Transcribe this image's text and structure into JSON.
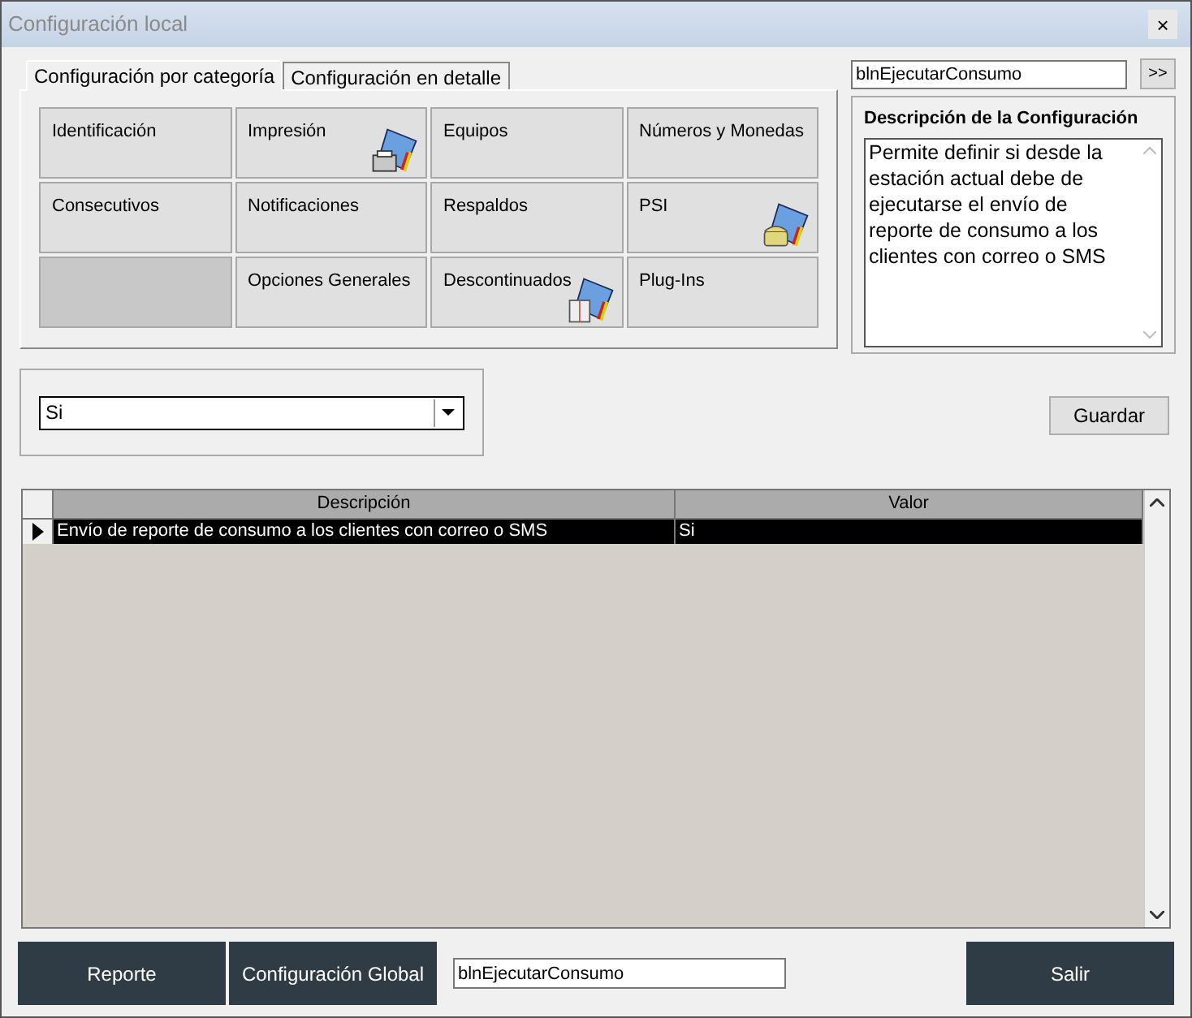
{
  "window": {
    "title": "Configuración local",
    "close": "×"
  },
  "tabs": [
    {
      "label": "Configuración por categoría",
      "selected": true
    },
    {
      "label": "Configuración en detalle",
      "selected": false
    }
  ],
  "categories": [
    {
      "label": "Identificación",
      "disabled": false
    },
    {
      "label": "Impresión",
      "disabled": false,
      "kind": "printer"
    },
    {
      "label": "Equipos",
      "disabled": false
    },
    {
      "label": "Números y Monedas",
      "disabled": false
    },
    {
      "label": "Consecutivos",
      "disabled": false
    },
    {
      "label": "Notificaciones",
      "disabled": false
    },
    {
      "label": "Respaldos",
      "disabled": false
    },
    {
      "label": "PSI",
      "disabled": false,
      "kind": "phone"
    },
    {
      "disabled": true
    },
    {
      "label": "Opciones Generales",
      "disabled": false
    },
    {
      "label": "Descontinuados",
      "disabled": false,
      "kind": "book"
    },
    {
      "label": "Plug-Ins",
      "disabled": false
    }
  ],
  "search": {
    "value": "blnEjecutarConsumo",
    "button": ">>"
  },
  "description": {
    "title": "Descripción de la Configuración",
    "text": "Permite definir si desde la estación actual debe de ejecutarse el envío de reporte de consumo a los clientes con correo o SMS"
  },
  "value_select": {
    "value": "Si"
  },
  "save_button": "Guardar",
  "table": {
    "columns": [
      "Descripción",
      "Valor"
    ],
    "rows": [
      {
        "cells": [
          "Envío de reporte de consumo a los clientes con correo o SMS",
          "Si"
        ],
        "selected": true
      }
    ]
  },
  "footer": {
    "buttons": [
      "Reporte",
      "Configuración Global"
    ],
    "field": "blnEjecutarConsumo",
    "exit": "Salir"
  }
}
